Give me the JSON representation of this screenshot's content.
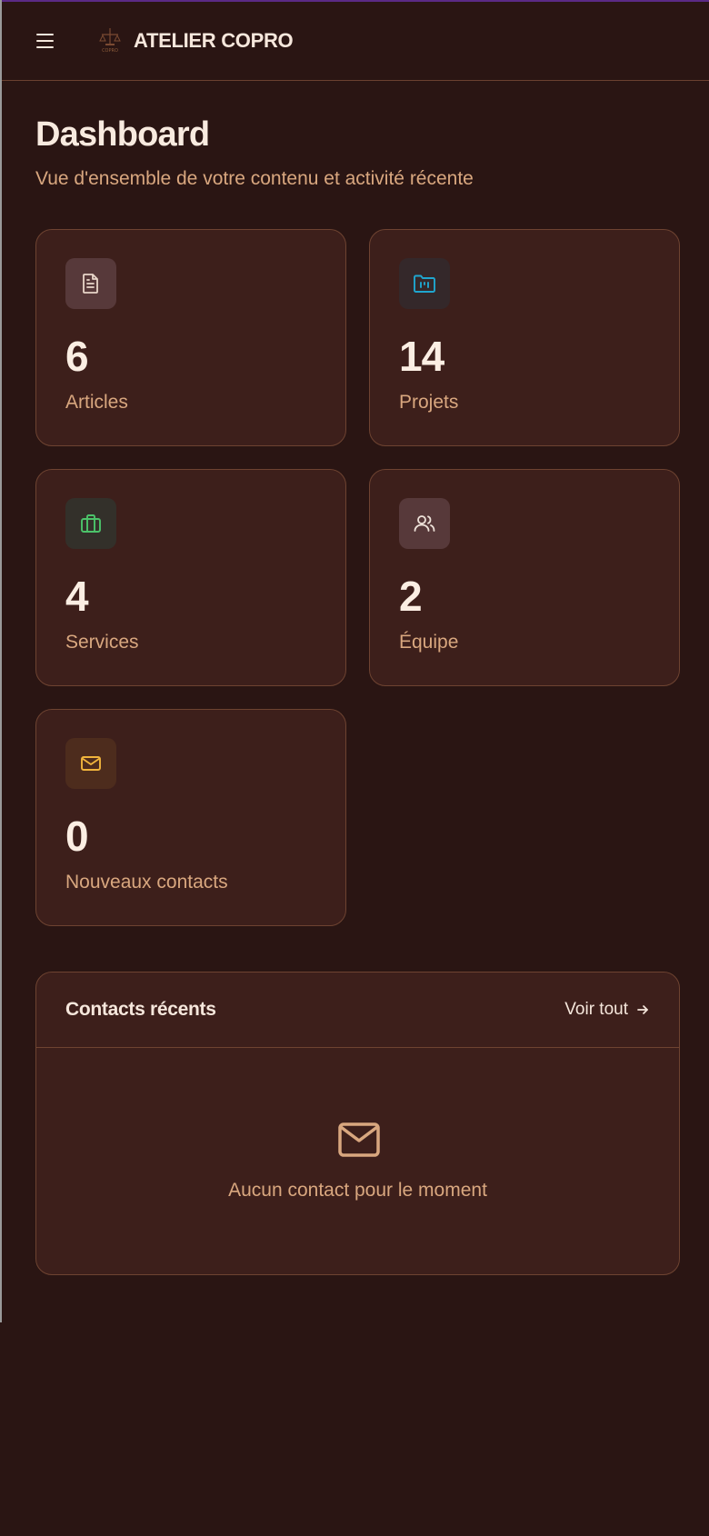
{
  "header": {
    "brand_title": "ATELIER COPRO",
    "logo_text": "COPRO"
  },
  "page": {
    "title": "Dashboard",
    "subtitle": "Vue d'ensemble de votre contenu et activité récente"
  },
  "stats": [
    {
      "value": "6",
      "label": "Articles",
      "icon": "document-icon",
      "color": "#e9d6c9"
    },
    {
      "value": "14",
      "label": "Projets",
      "icon": "folder-kanban-icon",
      "color": "#1fa6cf"
    },
    {
      "value": "4",
      "label": "Services",
      "icon": "briefcase-icon",
      "color": "#4cc36a"
    },
    {
      "value": "2",
      "label": "Équipe",
      "icon": "users-icon",
      "color": "#efe3da"
    },
    {
      "value": "0",
      "label": "Nouveaux contacts",
      "icon": "mail-icon",
      "color": "#f0b43c"
    }
  ],
  "recent_contacts": {
    "title": "Contacts récents",
    "view_all": "Voir tout",
    "empty_text": "Aucun contact pour le moment"
  },
  "colors": {
    "background": "#2a1513",
    "card": "#3d1f1b",
    "border": "#6e4331",
    "accent_text": "#d9a77f"
  }
}
